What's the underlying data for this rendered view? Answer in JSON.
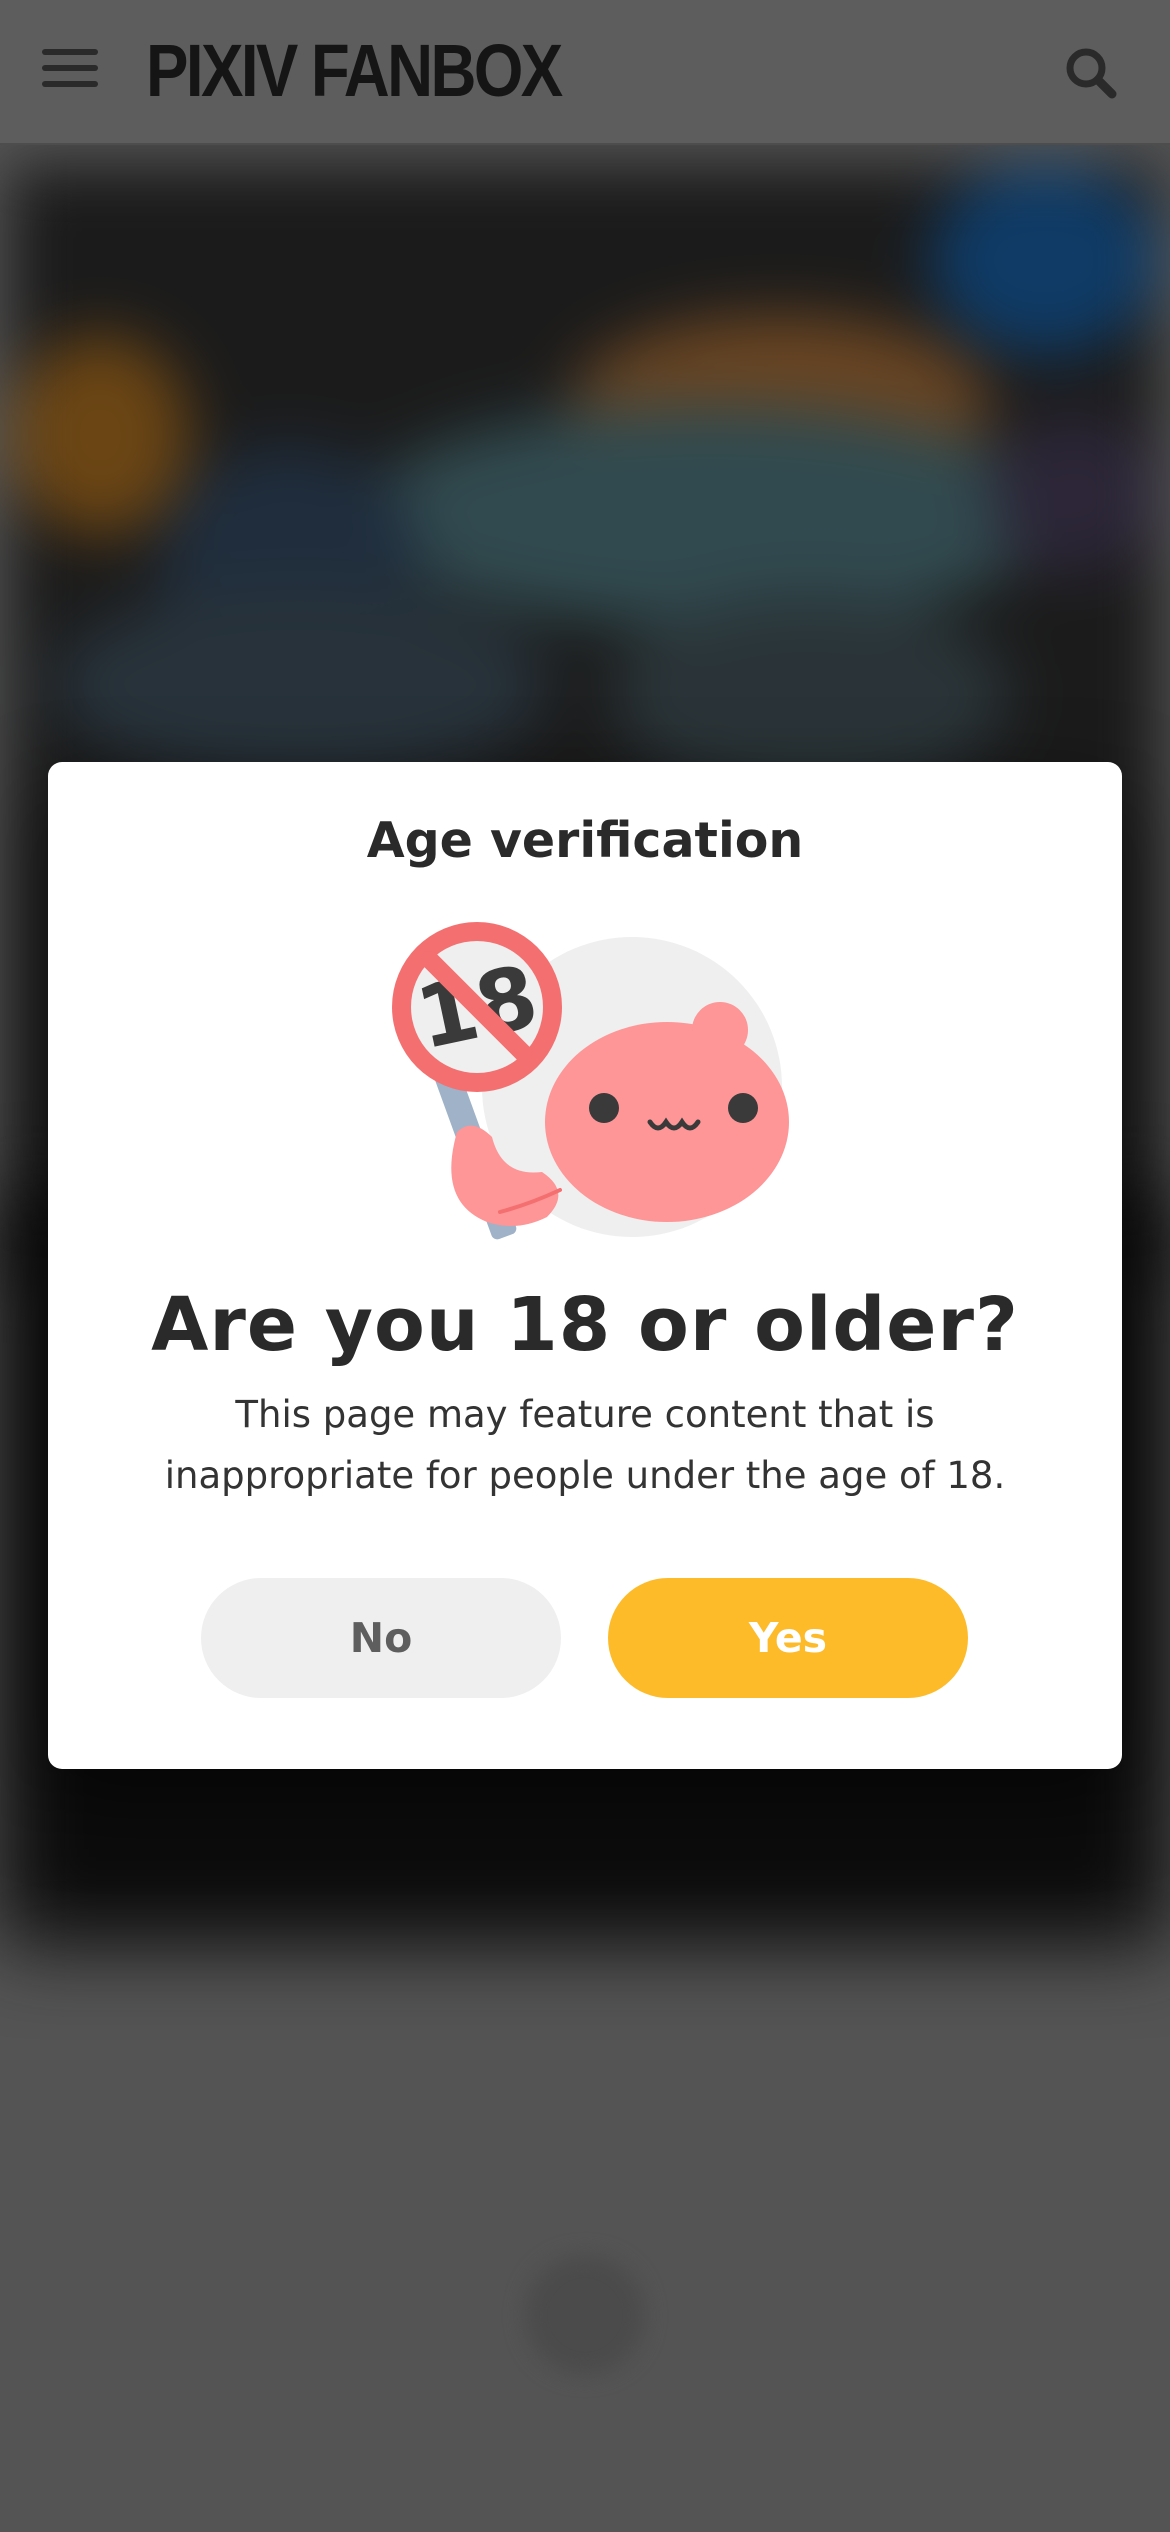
{
  "header": {
    "logo": "PIXIV FANBOX",
    "menu_icon": "hamburger-menu-icon",
    "search_icon": "search-icon"
  },
  "modal": {
    "title": "Age verification",
    "mascot_badge": "18",
    "question": "Are you 18 or older?",
    "description": "This page may feature content that is inappropriate for people under the age of 18.",
    "no_label": "No",
    "yes_label": "Yes"
  },
  "colors": {
    "overlay": "#545454",
    "header": "#5d5d5d",
    "modal_bg": "#ffffff",
    "yes_button": "#fdbb2a",
    "no_button": "#efefef",
    "mascot_pink": "#fe9596",
    "prohibition_red": "#f46f70"
  }
}
